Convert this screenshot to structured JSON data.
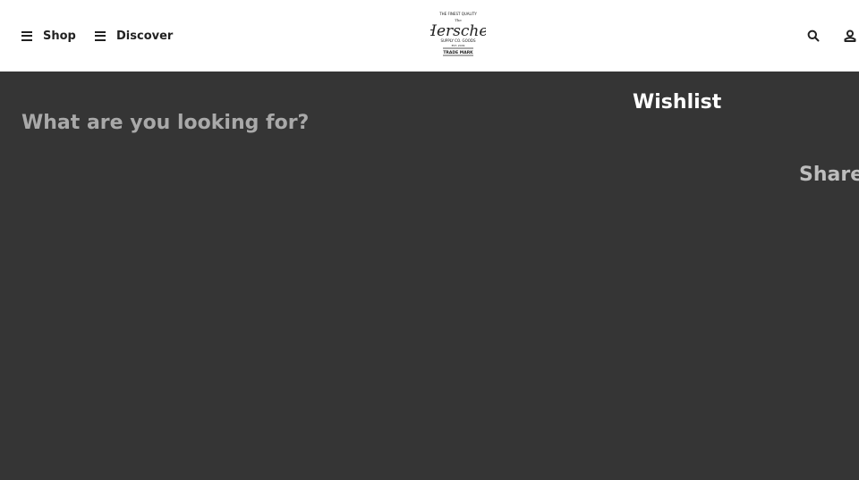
{
  "header": {
    "nav": {
      "shop_label": "Shop",
      "discover_label": "Discover"
    },
    "logo": {
      "top_text": "THE FINEST QUALITY",
      "the_text": "The",
      "brand": "Herschel",
      "subtitle": "SUPPLY CO. GOODS",
      "est": "EST. 2009",
      "trademark": "TRADE MARK"
    },
    "icons": {
      "search": "search-icon",
      "account": "account-icon",
      "menu": "hamburger-icon"
    }
  },
  "overlay": {
    "search_placeholder": "What are you looking for?",
    "wishlist_title": "Wishlist",
    "share_label": "Share"
  },
  "colors": {
    "header_bg": "#ffffff",
    "overlay_bg": "#353535",
    "wishlist_text": "#ffffff",
    "search_text": "#a9a9a9"
  }
}
